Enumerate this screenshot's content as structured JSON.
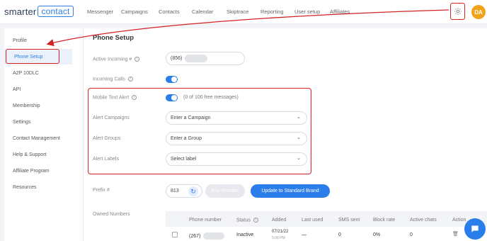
{
  "brand": {
    "name_plain": "smarter",
    "name_boxed": "contact"
  },
  "nav": [
    "Messenger",
    "Campaigns",
    "Contacts",
    "Calendar",
    "Skiptrace",
    "Reporting",
    "User setup",
    "Affiliates"
  ],
  "user": {
    "initials": "DA"
  },
  "sidebar": [
    "Profile",
    "Phone Setup",
    "A2P 10DLC",
    "API",
    "Membership",
    "Settings",
    "Contact Management",
    "Help & Support",
    "Affiliate Program",
    "Resources"
  ],
  "page": {
    "title": "Phone Setup",
    "active_incoming_label": "Active Incoming #",
    "active_incoming_value": "(856)",
    "incoming_calls_label": "Incoming Calls",
    "mobile_text_alert_label": "Mobile Text Alert",
    "free_messages": "(0 of 100 free messages)",
    "alert_campaigns_label": "Alert Campaigns",
    "alert_campaigns_placeholder": "Enter a Campaign",
    "alert_groups_label": "Alert Groups",
    "alert_groups_placeholder": "Enter a Group",
    "alert_labels_label": "Alert Labels",
    "alert_labels_placeholder": "Select label",
    "prefix_label": "Prefix #",
    "prefix_value": "813",
    "buy_number": "Buy Number",
    "update_brand": "Update to Standard Brand",
    "owned_numbers_label": "Owned Numbers"
  },
  "table": {
    "headers": [
      "Phone number",
      "Status",
      "Added",
      "Last used",
      "SMS sent",
      "Block rate",
      "Active chats",
      "Action"
    ],
    "row": {
      "phone": "(267)",
      "status": "Inactive",
      "added": "07/21/22",
      "added_time": "5:06 PM",
      "last_used": "—",
      "sms_sent": "0",
      "block_rate": "0%",
      "active_chats": "0"
    }
  },
  "colors": {
    "accent": "#2b7de9",
    "annotation": "#d22222"
  }
}
